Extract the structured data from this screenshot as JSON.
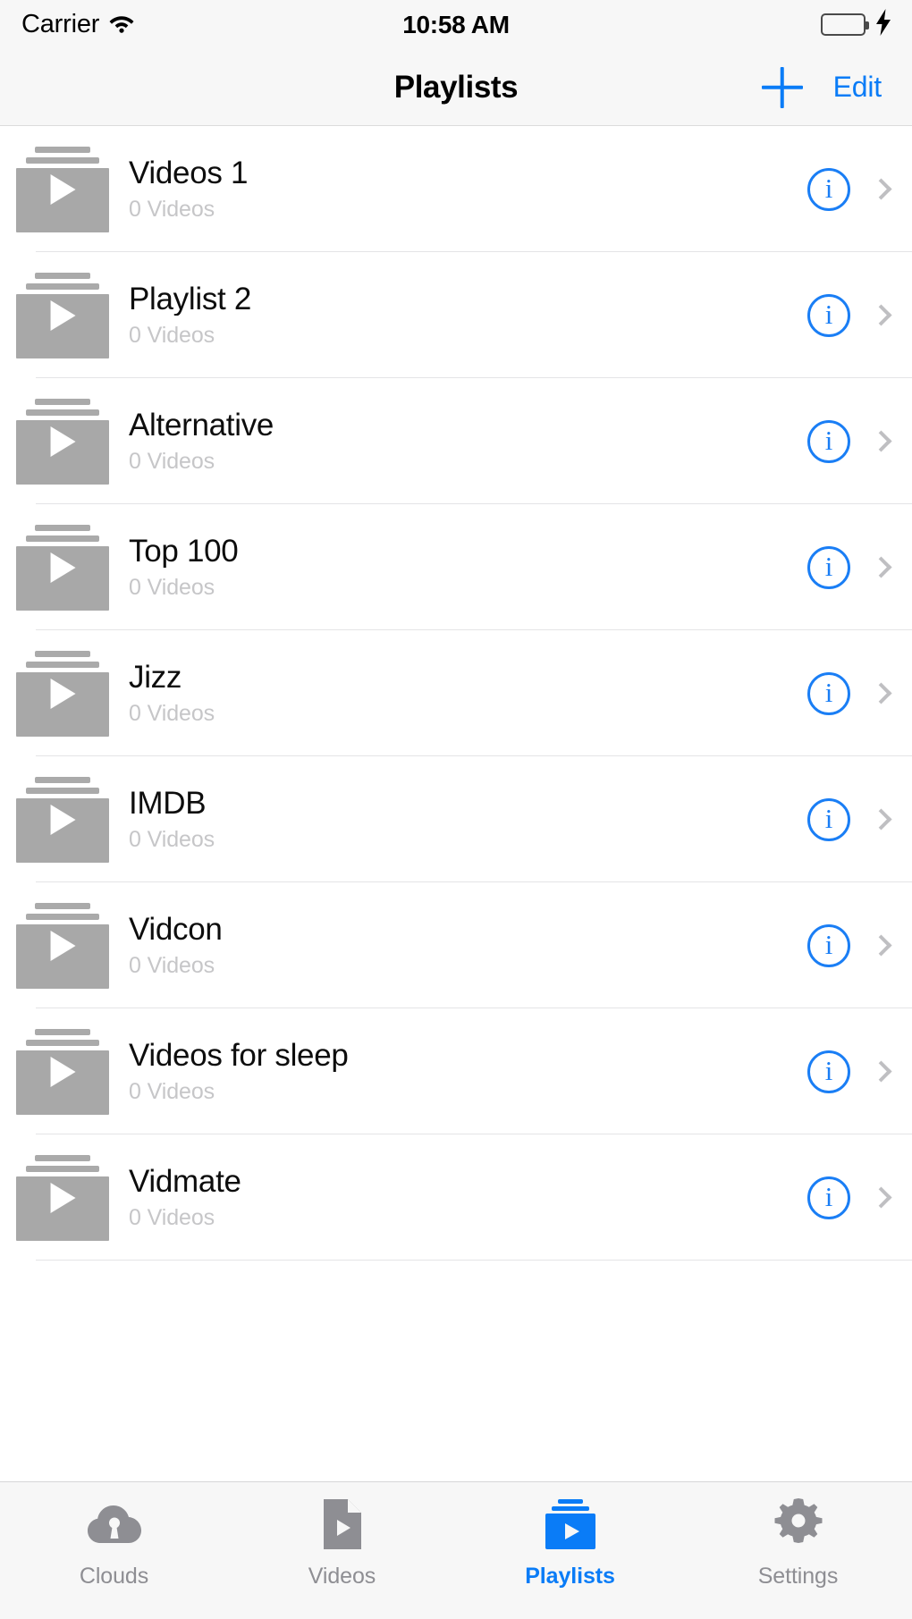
{
  "status_bar": {
    "carrier": "Carrier",
    "wifi_icon": "wifi-icon",
    "time": "10:58 AM",
    "battery_icon": "battery-icon",
    "battery_color": "#4cd964",
    "charging_icon": "lightning-bolt-icon"
  },
  "nav_bar": {
    "title": "Playlists",
    "add_icon": "plus-icon",
    "edit_label": "Edit",
    "accent_color": "#0a7cf7"
  },
  "list": {
    "subtitle_default": "0 Videos",
    "thumbnail_icon": "playlist-thumbnail-icon",
    "info_icon": "info-circle-icon",
    "disclosure_icon": "chevron-right-icon",
    "rows": [
      {
        "title": "Videos 1",
        "subtitle": "0 Videos"
      },
      {
        "title": "Playlist 2",
        "subtitle": "0 Videos"
      },
      {
        "title": "Alternative",
        "subtitle": "0 Videos"
      },
      {
        "title": "Top 100",
        "subtitle": "0 Videos"
      },
      {
        "title": "Jizz",
        "subtitle": "0 Videos"
      },
      {
        "title": "IMDB",
        "subtitle": "0 Videos"
      },
      {
        "title": "Vidcon",
        "subtitle": "0 Videos"
      },
      {
        "title": "Videos for sleep",
        "subtitle": "0 Videos"
      },
      {
        "title": "Vidmate",
        "subtitle": "0 Videos"
      }
    ]
  },
  "tab_bar": {
    "active_index": 2,
    "active_color": "#0a7cf7",
    "inactive_color": "#8e8e93",
    "tabs": [
      {
        "label": "Clouds",
        "icon": "cloud-lock-icon"
      },
      {
        "label": "Videos",
        "icon": "document-play-icon"
      },
      {
        "label": "Playlists",
        "icon": "playlist-stack-play-icon"
      },
      {
        "label": "Settings",
        "icon": "gear-icon"
      }
    ]
  }
}
